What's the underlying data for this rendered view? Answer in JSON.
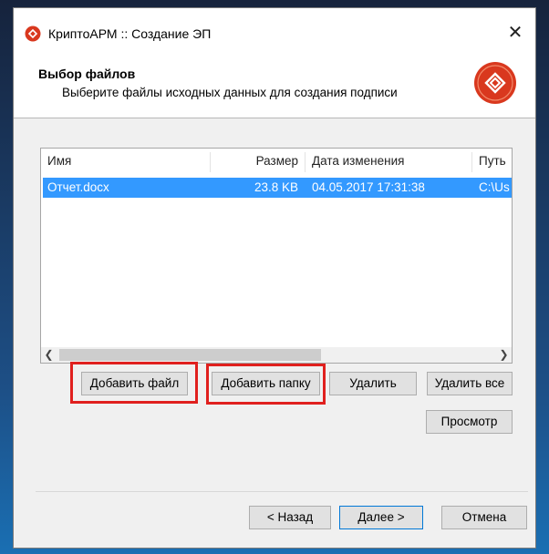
{
  "window": {
    "title": "КриптоАРМ :: Создание ЭП",
    "close_glyph": "✕"
  },
  "header": {
    "title": "Выбор файлов",
    "subtitle": "Выберите файлы исходных данных для создания подписи"
  },
  "file_list": {
    "columns": [
      "Имя",
      "Размер",
      "Дата изменения",
      "Путь"
    ],
    "rows": [
      {
        "name": "Отчет.docx",
        "size": "23.8 KB",
        "modified": "04.05.2017 17:31:38",
        "path": "C:\\Us"
      }
    ]
  },
  "buttons": {
    "add_file": "Добавить файл",
    "add_folder": "Добавить папку",
    "delete": "Удалить",
    "delete_all": "Удалить все",
    "view": "Просмотр",
    "back": "< Назад",
    "next": "Далее >",
    "cancel": "Отмена"
  },
  "highlights": [
    "add-file-button",
    "add-folder-button"
  ],
  "colors": {
    "selection": "#3399ff",
    "highlight": "#e0201e",
    "logo": "#d9381e"
  },
  "icons": {
    "app": "cryptoarm-logo-icon",
    "header": "cryptoarm-emblem-icon"
  }
}
